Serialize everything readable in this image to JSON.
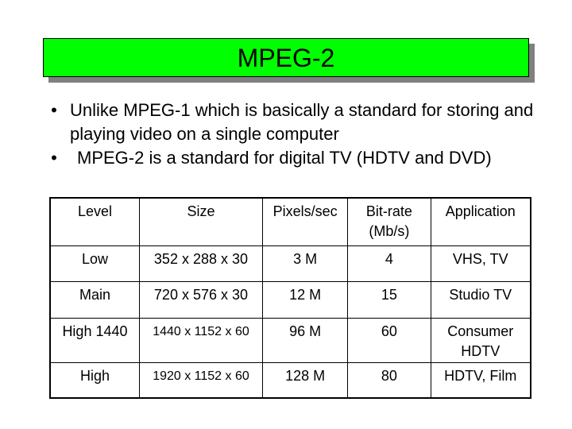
{
  "slide": {
    "title": "MPEG-2",
    "colors": {
      "title_fill": "#00ff00",
      "title_shadow": "#808080",
      "text": "#000000"
    },
    "bullets": [
      {
        "marker": "•",
        "text": "Unlike MPEG-1 which is basically a standard for storing and playing video on a single computer"
      },
      {
        "marker": "•",
        "text": "MPEG-2 is a standard for digital TV (HDTV and DVD)"
      }
    ],
    "table": {
      "headers": [
        "Level",
        "Size",
        "Pixels/sec",
        "Bit-rate (Mb/s)",
        "Application"
      ],
      "rows": [
        [
          "Low",
          "352 x 288 x 30",
          "3 M",
          "4",
          "VHS, TV"
        ],
        [
          "Main",
          "720 x 576 x 30",
          "12 M",
          "15",
          "Studio TV"
        ],
        [
          "High 1440",
          "1440 x 1152 x 60",
          "96 M",
          "60",
          "Consumer HDTV"
        ],
        [
          "High",
          "1920 x 1152 x 60",
          "128 M",
          "80",
          "HDTV, Film"
        ]
      ]
    }
  }
}
